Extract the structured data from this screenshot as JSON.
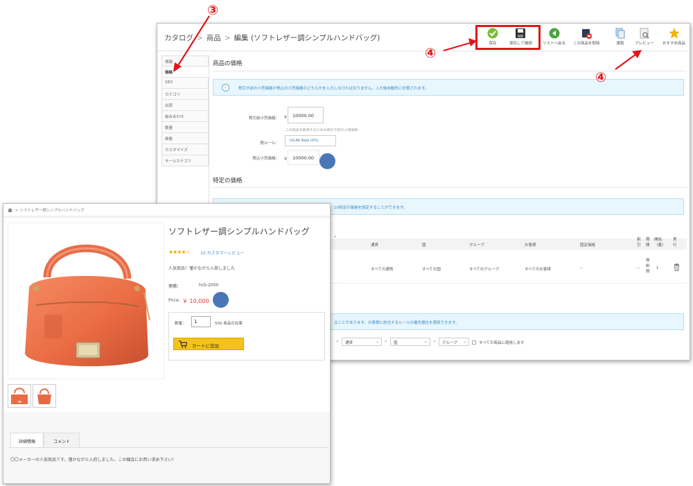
{
  "admin": {
    "breadcrumb": [
      "カタログ",
      "商品",
      "編集 (ソフトレザー調シンプルハンドバッグ)"
    ],
    "toolbar": [
      {
        "name": "save",
        "label": "保存",
        "icon": "check-circle-icon",
        "color": "#7cbb3d"
      },
      {
        "name": "save-stay",
        "label": "保存して継続",
        "icon": "floppy-disk-icon",
        "color": "#333333"
      },
      {
        "name": "back-to-list",
        "label": "リストへ戻る",
        "icon": "back-circle-icon",
        "color": "#4aa443"
      },
      {
        "name": "delete-product",
        "label": "この商品を削除",
        "icon": "delete-doc-icon",
        "color": "#333333"
      },
      {
        "name": "duplicate",
        "label": "複製",
        "icon": "copy-doc-icon",
        "color": "#6b9fd0"
      },
      {
        "name": "preview",
        "label": "プレビュー",
        "icon": "preview-doc-icon",
        "color": "#888888"
      },
      {
        "name": "recommended",
        "label": "おすすめ商品",
        "icon": "star-icon",
        "color": "#f5b400"
      }
    ],
    "sidebar_tabs": [
      "情報",
      "価格",
      "SEO",
      "カテゴリ",
      "出荷",
      "組み合わせ",
      "数量",
      "画像",
      "カスタマイズ",
      "モールカテゴリ"
    ],
    "active_tab": "価格",
    "price_section": {
      "title": "商品の価格",
      "info": "税引き前の小売価格か税込の小売価格のどちらかを入力しなければなりません。入力後自動的に計算されます。",
      "pretax_label": "税引前小売価格：",
      "currency": "￥",
      "pretax_value": "10000.00",
      "pretax_hint": "この商品を販売するための税引き前の小売価格",
      "tax_rule_label": "税ルール：",
      "tax_rule_value": "US-AK Rate (0%)",
      "final_label": "税込小売価格：",
      "final_value": "10000.00"
    },
    "specific_section": {
      "title": "特定の価格",
      "info": "10特定の価格を設定することができます。",
      "columns": [
        "通貨",
        "国",
        "グループ",
        "お客様",
        "固定価格",
        "割引",
        "期間",
        "開始（量）",
        "実行"
      ],
      "row": [
        "すべての通貨",
        "すべての国",
        "すべてのグループ",
        "すべてのお客様",
        "--",
        "--",
        "無制限",
        "1"
      ]
    },
    "priority_section": {
      "info": "ることがあります。お客様に該当するルールの優先順位を適用できます。",
      "selects": [
        "通貨",
        "国",
        "グループ"
      ],
      "apply_all": "すべての商品に適用します"
    }
  },
  "store": {
    "breadcrumb": "ソフトレザー調シンプルハンドバッグ",
    "title": "ソフトレザー調シンプルハンドバッグ",
    "stars": "★★★★☆",
    "reviews": "10 カスタマーレビュー",
    "popular": "人気商品！僅かながら入荷しました",
    "ref_label": "参照：",
    "ref_value": "hcb-2000",
    "price_label": "Price:",
    "price_value": "￥ 10,000",
    "qty_label": "数量：",
    "qty_value": "1",
    "stock": "500 商品の在庫",
    "add_to_cart": "カートに追加",
    "tabs": [
      "詳細情報",
      "コメント"
    ],
    "description": "〇〇メーカーの人気商品です。僅かながら入荷しました。この機会にお買い求め下さい！"
  },
  "annotations": {
    "badge3": "③",
    "badge4a": "④",
    "badge4b": "④"
  }
}
